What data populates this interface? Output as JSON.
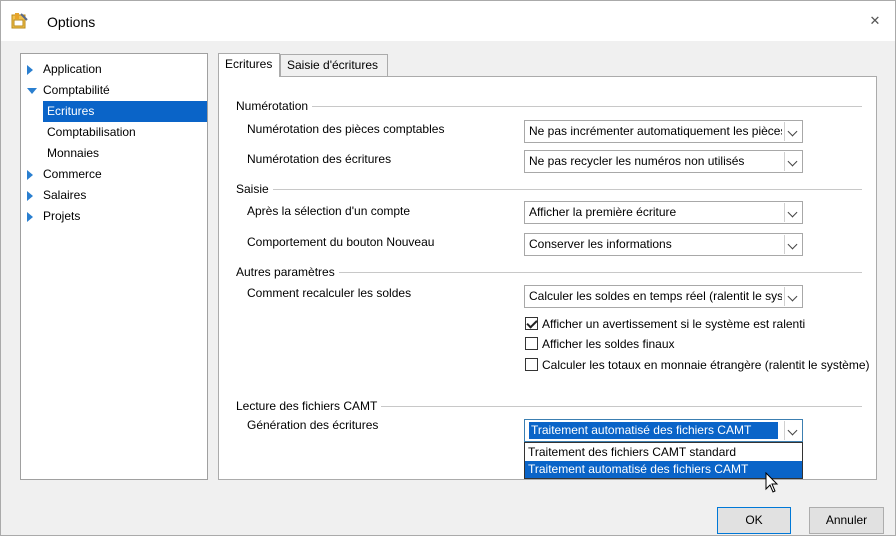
{
  "window": {
    "title": "Options",
    "close_glyph": "✕"
  },
  "tree": {
    "items": [
      {
        "label": "Application",
        "icon": "arrow-right-icon"
      },
      {
        "label": "Comptabilité",
        "icon": "arrow-down-icon"
      },
      {
        "label": "Ecritures",
        "selected": true
      },
      {
        "label": "Comptabilisation"
      },
      {
        "label": "Monnaies"
      },
      {
        "label": "Commerce",
        "icon": "arrow-right-icon"
      },
      {
        "label": "Salaires",
        "icon": "arrow-right-icon"
      },
      {
        "label": "Projets",
        "icon": "arrow-right-icon"
      }
    ]
  },
  "tabs": [
    {
      "label": "Ecritures",
      "active": true
    },
    {
      "label": "Saisie d'écritures"
    }
  ],
  "groups": {
    "numerotation": {
      "title": "Numérotation",
      "pieces_label": "Numérotation des pièces comptables",
      "pieces_value": "Ne pas incrémenter automatiquement les pièces",
      "ecritures_label": "Numérotation des écritures",
      "ecritures_value": "Ne pas recycler les numéros non utilisés"
    },
    "saisie": {
      "title": "Saisie",
      "apres_label": "Après la sélection d'un compte",
      "apres_value": "Afficher la première écriture",
      "nouveau_label": "Comportement du bouton Nouveau",
      "nouveau_value": "Conserver les informations"
    },
    "autres": {
      "title": "Autres paramètres",
      "soldes_label": "Comment recalculer les soldes",
      "soldes_value": "Calculer les soldes en temps réel (ralentit le système)",
      "check_avertissement": "Afficher un avertissement si le système est ralenti",
      "check_avertissement_checked": true,
      "check_soldes_finaux": "Afficher les soldes finaux",
      "check_soldes_finaux_checked": false,
      "check_totaux": "Calculer les totaux en monnaie étrangère (ralentit le système)",
      "check_totaux_checked": false
    },
    "camt": {
      "title": "Lecture des fichiers CAMT",
      "generation_label": "Génération des écritures",
      "generation_value": "Traitement automatisé des fichiers CAMT",
      "options": [
        "Traitement des fichiers CAMT standard",
        "Traitement automatisé des fichiers CAMT"
      ],
      "highlighted_option": 1
    }
  },
  "buttons": {
    "ok": "OK",
    "cancel": "Annuler"
  },
  "colors": {
    "accent": "#0a64c8",
    "tree_arrow": "#2a7fd0"
  }
}
